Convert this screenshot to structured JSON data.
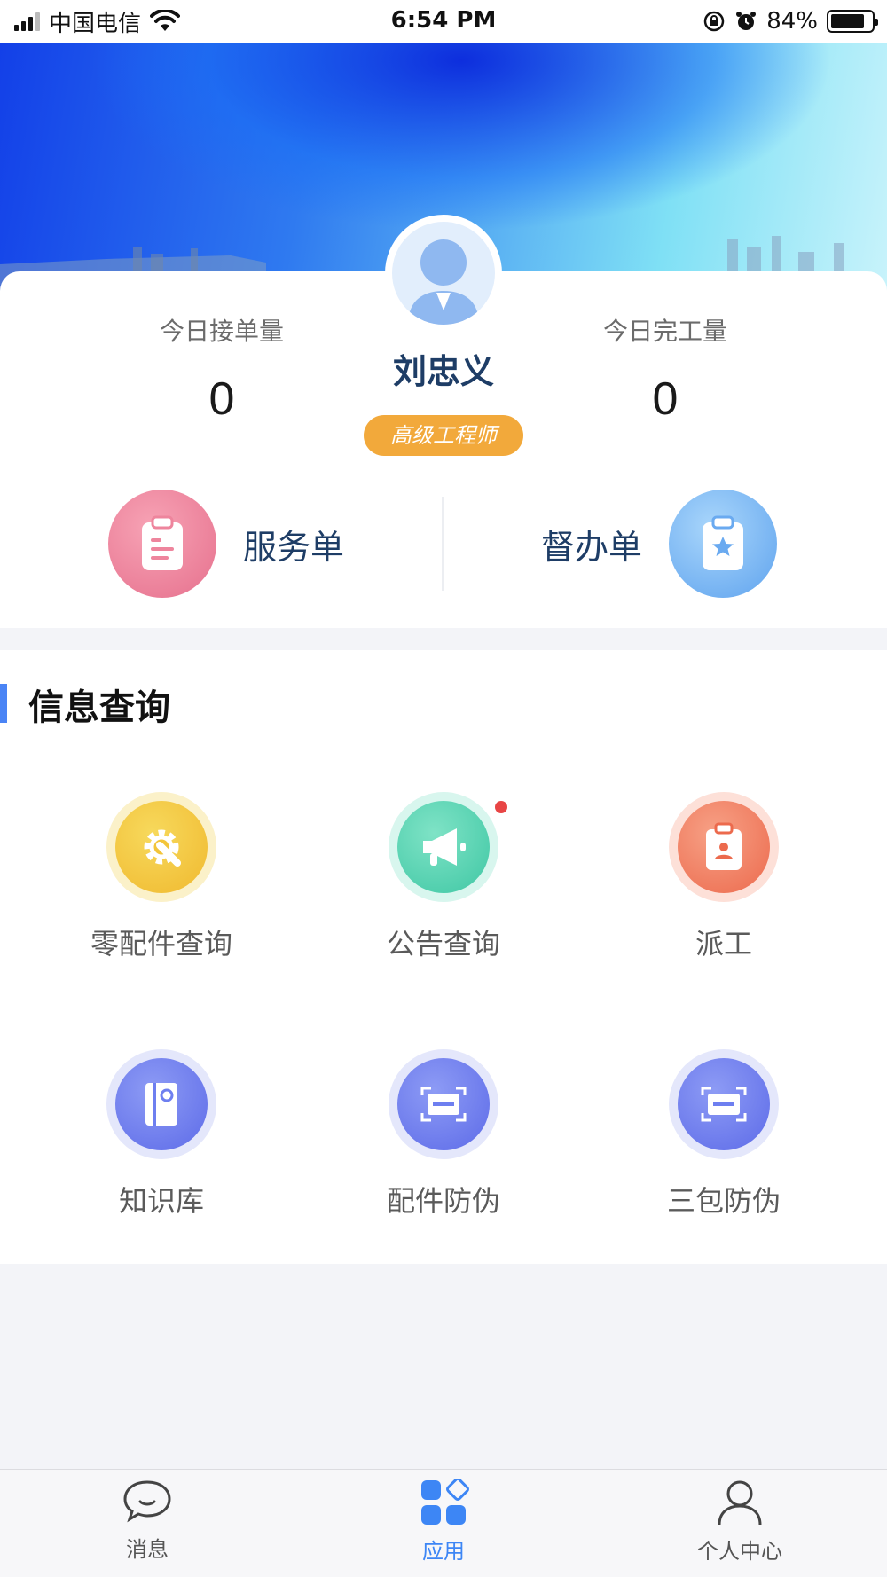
{
  "status_bar": {
    "carrier": "中国电信",
    "time": "6:54 PM",
    "battery": "84%",
    "battery_level": 0.84
  },
  "profile": {
    "name": "刘忠义",
    "title": "高级工程师"
  },
  "stats": [
    {
      "label": "今日接单量",
      "value": "0"
    },
    {
      "label": "今日完工量",
      "value": "0"
    }
  ],
  "quick_actions": [
    {
      "label": "服务单",
      "icon": "clipboard-list-icon"
    },
    {
      "label": "督办单",
      "icon": "clipboard-star-icon"
    }
  ],
  "section": {
    "title": "信息查询",
    "items": [
      {
        "label": "零配件查询",
        "icon": "gear-wrench-icon",
        "color": "#f3c53a"
      },
      {
        "label": "公告查询",
        "icon": "megaphone-icon",
        "color": "#4fd3b1",
        "has_notification": true
      },
      {
        "label": "派工",
        "icon": "badge-person-icon",
        "color": "#f07b5d"
      },
      {
        "label": "知识库",
        "icon": "notebook-icon",
        "color": "#6e7ff0"
      },
      {
        "label": "配件防伪",
        "icon": "scan-icon",
        "color": "#6e7ff0"
      },
      {
        "label": "三包防伪",
        "icon": "scan-icon",
        "color": "#6e7ff0"
      }
    ]
  },
  "tab_bar": {
    "tabs": [
      {
        "label": "消息",
        "icon": "chat-bubble-icon"
      },
      {
        "label": "应用",
        "icon": "apps-icon",
        "active": true
      },
      {
        "label": "个人中心",
        "icon": "person-icon"
      }
    ]
  },
  "colors": {
    "accent": "#3d86f5",
    "badge": "#f2a93b",
    "name": "#1e3d66"
  }
}
